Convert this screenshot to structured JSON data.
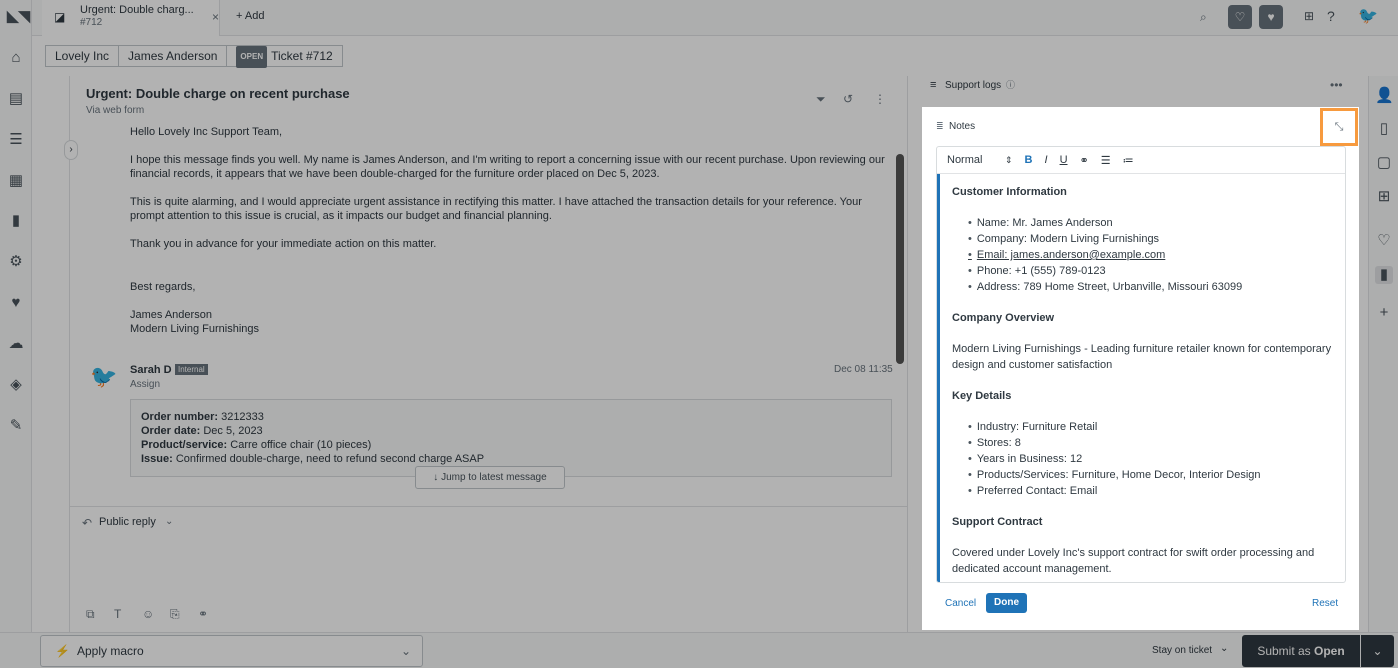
{
  "tab": {
    "title": "Urgent: Double charg...",
    "subtitle": "#712",
    "close": "×",
    "add": "+ Add"
  },
  "breadcrumb": {
    "org": "Lovely Inc",
    "requester": "James Anderson",
    "status_badge": "OPEN",
    "ticket": "Ticket #712"
  },
  "ticket": {
    "subject": "Urgent: Double charge on recent purchase",
    "via": "Via web form",
    "message": {
      "greeting": "Hello Lovely Inc Support Team,",
      "p1": "I hope this message finds you well. My name is James Anderson, and I'm writing to report a concerning issue with our recent purchase. Upon reviewing our financial records, it appears that we have been double-charged for the furniture order placed on Dec 5, 2023.",
      "p2": "This is quite alarming, and I would appreciate urgent assistance in rectifying this matter. I have attached the transaction details for your reference. Your prompt attention to this issue is crucial, as it impacts our budget and financial planning.",
      "p3": "Thank you in advance for your immediate action on this matter.",
      "closing": "Best regards,",
      "sig_name": "James Anderson",
      "sig_company": "Modern Living Furnishings"
    },
    "internal": {
      "author": "Sarah D",
      "badge": "Internal",
      "assign": "Assign",
      "time": "Dec 08 11:35",
      "order_number_label": "Order number:",
      "order_number": "3212333",
      "order_date_label": "Order date:",
      "order_date": "Dec 5, 2023",
      "product_label": "Product/service:",
      "product": "Carre office chair (10 pieces)",
      "issue_label": "Issue:",
      "issue": "Confirmed double-charge, need to refund second charge ASAP"
    },
    "jump_label": "Jump to latest message"
  },
  "reply": {
    "mode": "Public reply"
  },
  "bottom": {
    "macro": "Apply macro",
    "stay": "Stay on ticket",
    "submit_prefix": "Submit as",
    "submit_status": "Open"
  },
  "context": {
    "section": "Support logs"
  },
  "notes": {
    "title": "Notes",
    "format": "Normal",
    "h1": "Customer Information",
    "customer": [
      "Name: Mr. James Anderson",
      "Company: Modern Living Furnishings",
      "Email: james.anderson@example.com",
      "Phone: +1 (555) 789-0123",
      "Address: 789 Home Street, Urbanville, Missouri 63099"
    ],
    "h2": "Company Overview",
    "overview": "Modern Living Furnishings - Leading furniture retailer known for contemporary design and customer satisfaction",
    "h3": "Key Details",
    "details": [
      "Industry: Furniture Retail",
      "Stores: 8",
      "Years in Business: 12",
      "Products/Services: Furniture, Home Decor, Interior Design",
      "Preferred Contact: Email"
    ],
    "h4": "Support Contract",
    "contract": "Covered under Lovely Inc's support contract for swift order processing and dedicated account management.",
    "cancel": "Cancel",
    "done": "Done",
    "reset": "Reset"
  }
}
